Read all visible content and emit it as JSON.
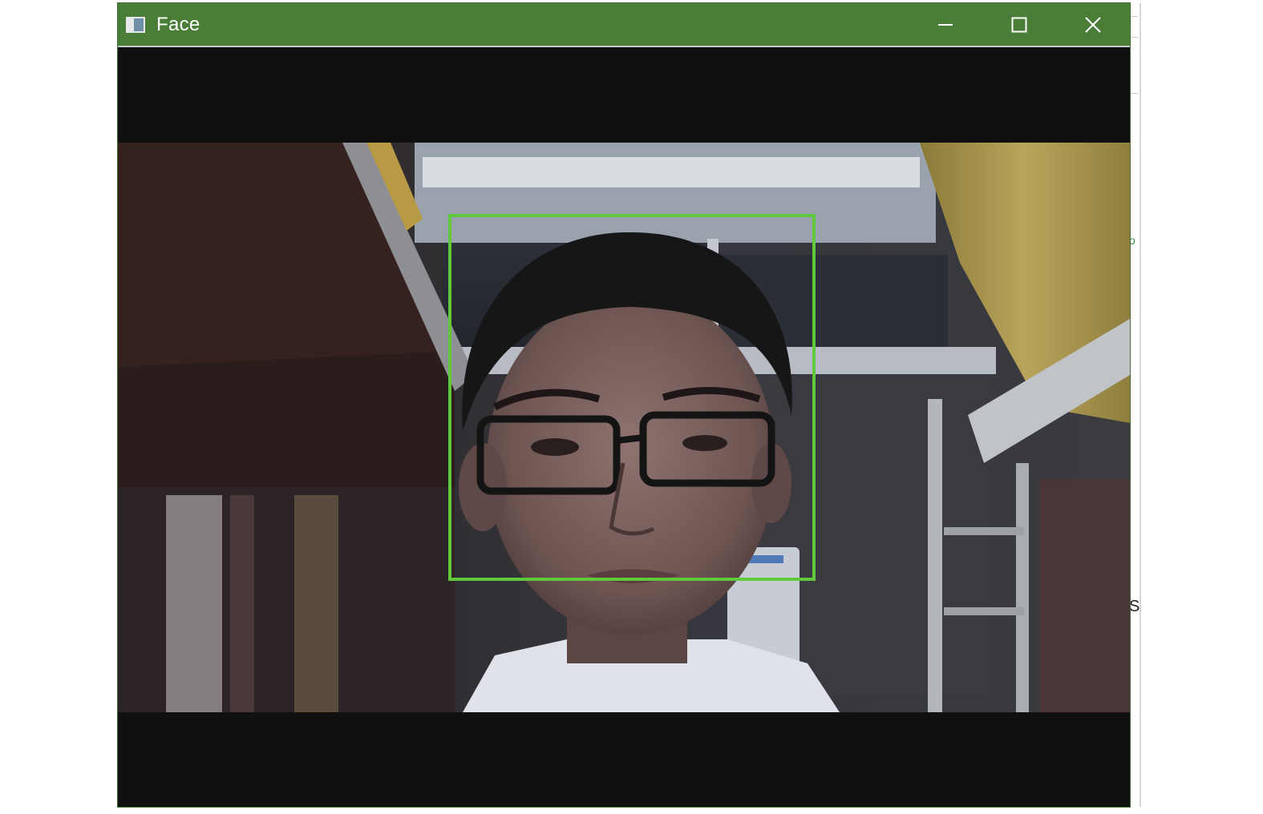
{
  "window": {
    "title": "Face"
  },
  "titlebar": {
    "icon": "opencv-window-icon",
    "controls": [
      "minimize-icon",
      "maximize-icon",
      "close-icon"
    ]
  },
  "detection": {
    "count": 1,
    "box_color": "#5fc83b"
  },
  "colors": {
    "titlebar": "#4a7e38",
    "letterbox": "#101010"
  }
}
